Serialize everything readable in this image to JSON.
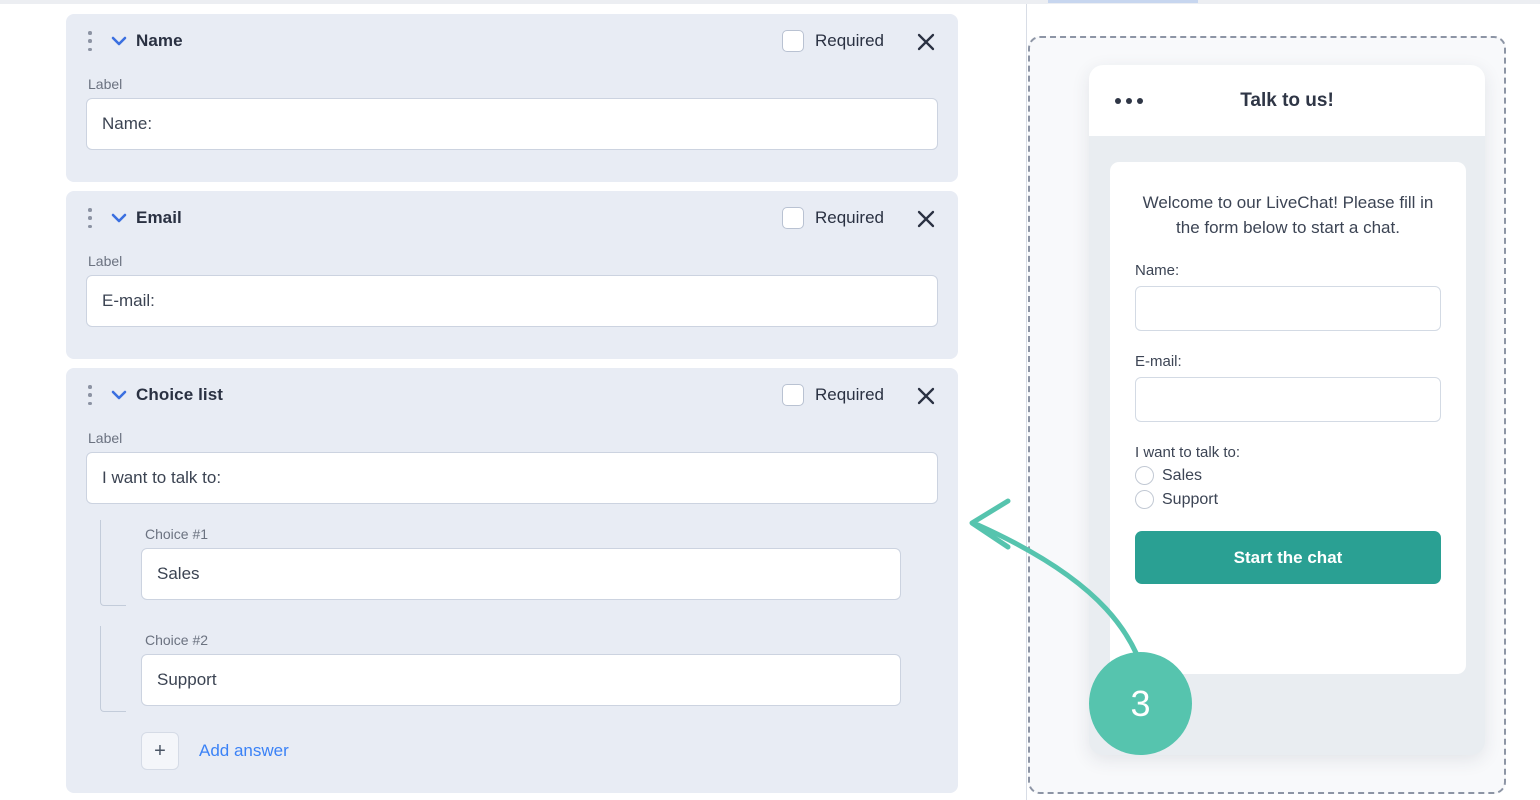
{
  "editor": {
    "fields": [
      {
        "id": "name",
        "title": "Name",
        "required_label": "Required",
        "required_checked": false,
        "sub_label": "Label",
        "value": "Name:",
        "drag_icon": "drag-handle-icon",
        "collapse_icon": "chevron-down-icon",
        "close_icon": "close-icon"
      },
      {
        "id": "email",
        "title": "Email",
        "required_label": "Required",
        "required_checked": false,
        "sub_label": "Label",
        "value": "E-mail:",
        "drag_icon": "drag-handle-icon",
        "collapse_icon": "chevron-down-icon",
        "close_icon": "close-icon"
      },
      {
        "id": "choice",
        "title": "Choice list",
        "required_label": "Required",
        "required_checked": false,
        "sub_label": "Label",
        "value": "I want to talk to:",
        "drag_icon": "drag-handle-icon",
        "collapse_icon": "chevron-down-icon",
        "close_icon": "close-icon",
        "choices": [
          {
            "label": "Choice #1",
            "value": "Sales"
          },
          {
            "label": "Choice #2",
            "value": "Support"
          }
        ],
        "add_answer": {
          "plus": "+",
          "label": "Add answer"
        }
      }
    ]
  },
  "preview": {
    "header": {
      "title": "Talk to us!",
      "menu_icon": "more-dots-icon"
    },
    "welcome": "Welcome to our LiveChat! Please fill in the form below to start a chat.",
    "fields": [
      {
        "label": "Name:",
        "value": ""
      },
      {
        "label": "E-mail:",
        "value": ""
      }
    ],
    "choice": {
      "label": "I want to talk to:",
      "options": [
        "Sales",
        "Support"
      ],
      "selected": ""
    },
    "submit_label": "Start the chat"
  },
  "annotation": {
    "step_number": "3",
    "arrow_icon": "curved-arrow-left-icon"
  },
  "colors": {
    "card_bg": "#e8ecf4",
    "accent_blue": "#3b82f6",
    "teal_button": "#2aa093",
    "teal_badge": "#56c4ae",
    "text_dark": "#2a3142"
  }
}
